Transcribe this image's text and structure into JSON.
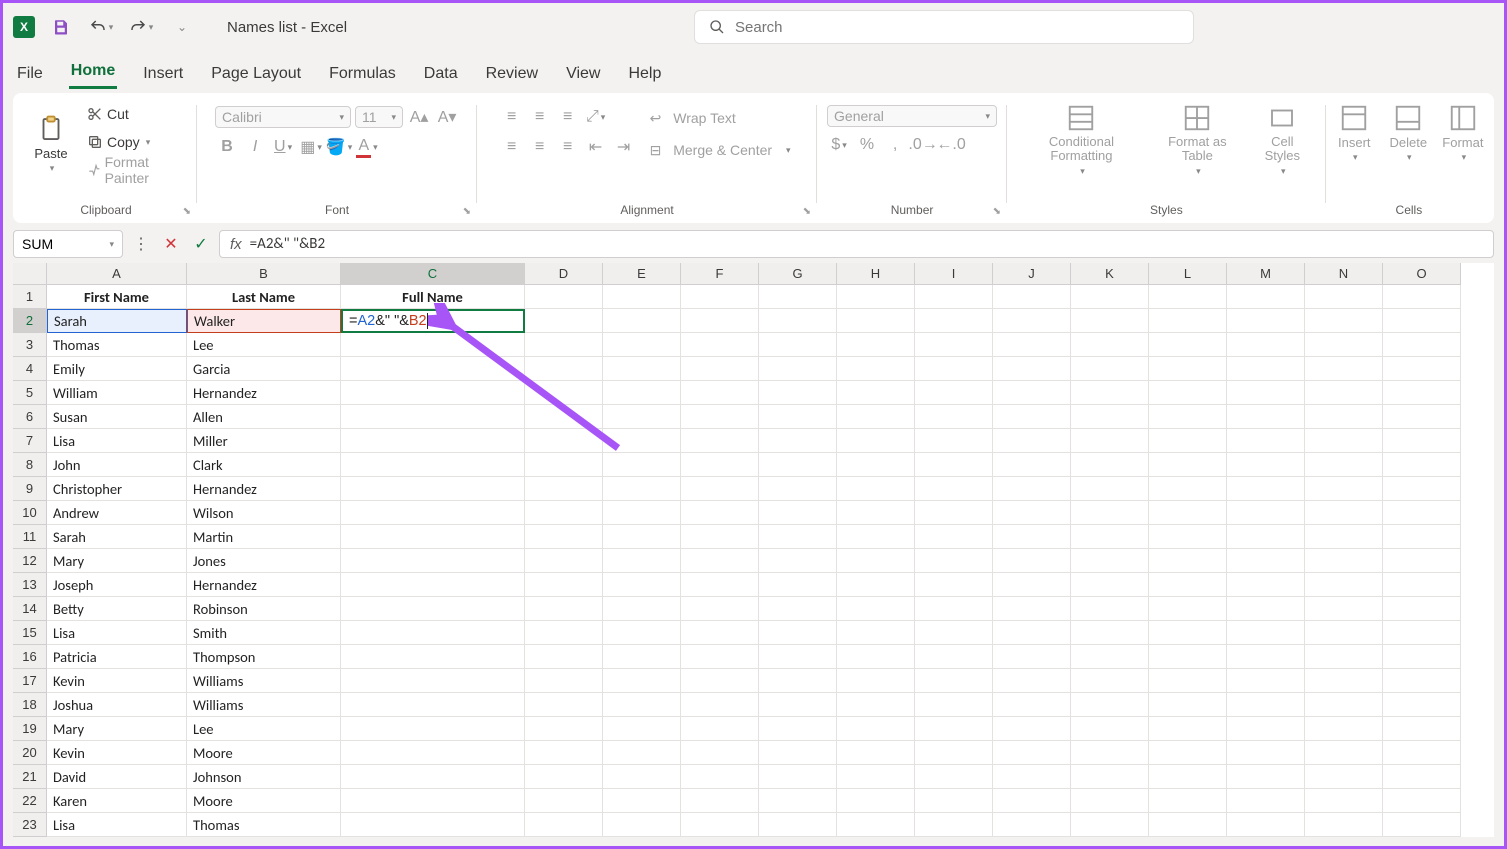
{
  "app": {
    "title": "Names list  -  Excel",
    "logo_letter": "X"
  },
  "search": {
    "placeholder": "Search"
  },
  "tabs": [
    "File",
    "Home",
    "Insert",
    "Page Layout",
    "Formulas",
    "Data",
    "Review",
    "View",
    "Help"
  ],
  "active_tab": 1,
  "ribbon": {
    "clipboard": {
      "label": "Clipboard",
      "paste": "Paste",
      "cut": "Cut",
      "copy": "Copy",
      "format_painter": "Format Painter"
    },
    "font": {
      "label": "Font",
      "name": "Calibri",
      "size": "11"
    },
    "alignment": {
      "label": "Alignment",
      "wrap": "Wrap Text",
      "merge": "Merge & Center"
    },
    "number": {
      "label": "Number",
      "format": "General"
    },
    "styles": {
      "label": "Styles",
      "cond": "Conditional Formatting",
      "table": "Format as Table",
      "cell": "Cell Styles"
    },
    "cells": {
      "label": "Cells",
      "insert": "Insert",
      "delete": "Delete",
      "format": "Format"
    }
  },
  "formula_bar": {
    "name_box": "SUM",
    "formula": "=A2&\" \"&B2"
  },
  "grid": {
    "cols": [
      "A",
      "B",
      "C",
      "D",
      "E",
      "F",
      "G",
      "H",
      "I",
      "J",
      "K",
      "L",
      "M",
      "N",
      "O"
    ],
    "col_widths": {
      "default": 78,
      "A": 140,
      "B": 154,
      "C": 184
    },
    "cell_C2_parts": {
      "prefix": "=",
      "refA": "A2",
      "mid": "&\" \"&",
      "refB": "B2"
    },
    "headers": [
      "First Name",
      "Last Name",
      "Full Name"
    ],
    "rows": [
      {
        "first": "Sarah",
        "last": "Walker"
      },
      {
        "first": "Thomas",
        "last": "Lee"
      },
      {
        "first": "Emily",
        "last": "Garcia"
      },
      {
        "first": "William",
        "last": "Hernandez"
      },
      {
        "first": "Susan",
        "last": "Allen"
      },
      {
        "first": "Lisa",
        "last": "Miller"
      },
      {
        "first": "John",
        "last": "Clark"
      },
      {
        "first": "Christopher",
        "last": "Hernandez"
      },
      {
        "first": "Andrew",
        "last": "Wilson"
      },
      {
        "first": "Sarah",
        "last": "Martin"
      },
      {
        "first": "Mary",
        "last": "Jones"
      },
      {
        "first": "Joseph",
        "last": "Hernandez"
      },
      {
        "first": "Betty",
        "last": "Robinson"
      },
      {
        "first": "Lisa",
        "last": "Smith"
      },
      {
        "first": "Patricia",
        "last": "Thompson"
      },
      {
        "first": "Kevin",
        "last": "Williams"
      },
      {
        "first": "Joshua",
        "last": "Williams"
      },
      {
        "first": "Mary",
        "last": "Lee"
      },
      {
        "first": "Kevin",
        "last": "Moore"
      },
      {
        "first": "David",
        "last": "Johnson"
      },
      {
        "first": "Karen",
        "last": "Moore"
      },
      {
        "first": "Lisa",
        "last": "Thomas"
      }
    ]
  }
}
